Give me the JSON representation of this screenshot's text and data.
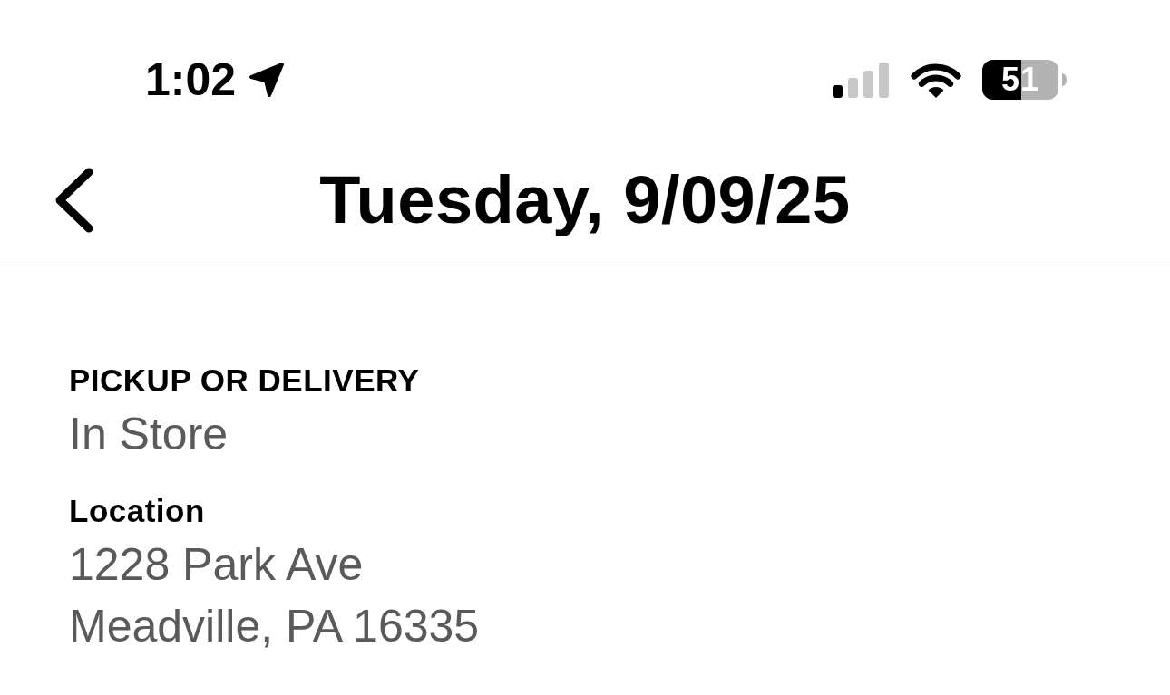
{
  "status_bar": {
    "time": "1:02",
    "battery": "51"
  },
  "header": {
    "title": "Tuesday, 9/09/25"
  },
  "fields": [
    {
      "label": "PICKUP OR DELIVERY",
      "lines": [
        "In Store"
      ]
    },
    {
      "label": "Location",
      "lines": [
        "1228 Park Ave",
        "Meadville, PA 16335"
      ]
    }
  ]
}
